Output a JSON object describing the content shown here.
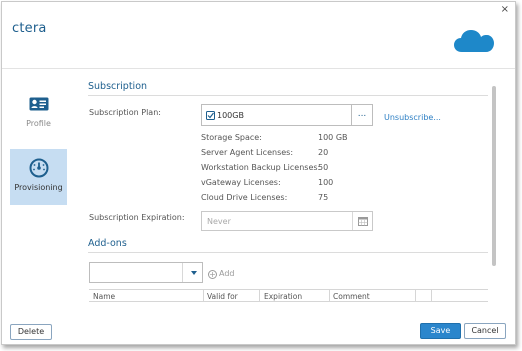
{
  "app": {
    "title": "ctera",
    "close": "×"
  },
  "sidebar": {
    "items": [
      {
        "label": "Profile"
      },
      {
        "label": "Provisioning"
      }
    ]
  },
  "subscription": {
    "section_title": "Subscription",
    "plan_label": "Subscription Plan:",
    "plan_value": "100GB",
    "browse_label": "...",
    "unsubscribe_label": "Unsubscribe...",
    "details": [
      {
        "label": "Storage Space:",
        "value": "100 GB"
      },
      {
        "label": "Server Agent Licenses:",
        "value": "20"
      },
      {
        "label": "Workstation Backup Licenses:",
        "value": "50"
      },
      {
        "label": "vGateway Licenses:",
        "value": "100"
      },
      {
        "label": "Cloud Drive Licenses:",
        "value": "75"
      }
    ],
    "expiration_label": "Subscription Expiration:",
    "expiration_placeholder": "Never"
  },
  "addons": {
    "section_title": "Add-ons",
    "add_label": "Add",
    "columns": [
      "Name",
      "Valid for",
      "Expiration",
      "Comment"
    ]
  },
  "footer": {
    "delete_label": "Delete",
    "save_label": "Save",
    "cancel_label": "Cancel"
  },
  "colors": {
    "accent": "#1e5f8e",
    "link": "#2d7fc4",
    "selected_nav": "#c6ddf2",
    "primary_button": "#2b86cc",
    "cloud": "#1e88c9"
  }
}
